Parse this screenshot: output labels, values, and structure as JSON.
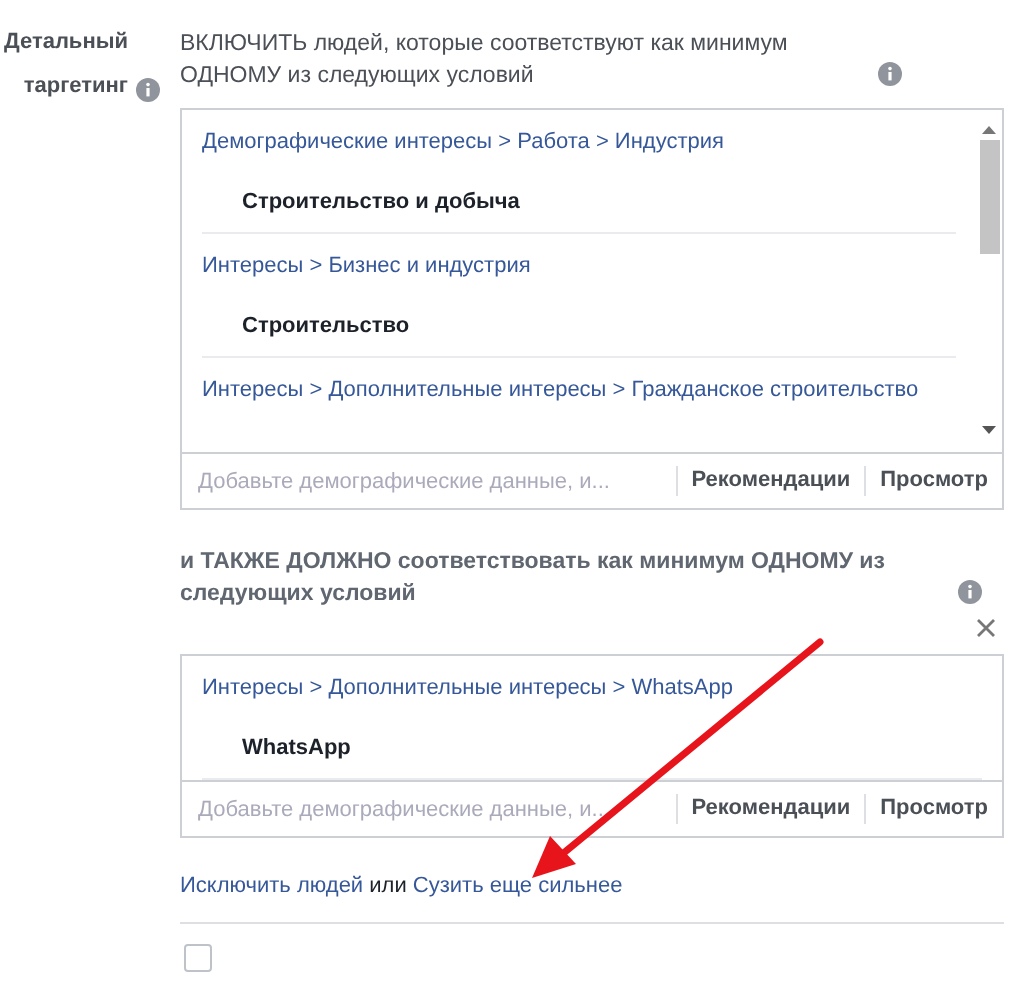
{
  "section_label": "Детальный таргетинг",
  "include": {
    "heading": "ВКЛЮЧИТЬ людей, которые соответствуют как минимум ОДНОМУ из следующих условий",
    "items": [
      {
        "path": "Демографические интересы > Работа > Индустрия",
        "value": "Строительство и добыча"
      },
      {
        "path": "Интересы > Бизнес и индустрия",
        "value": "Строительство"
      },
      {
        "path": "Интересы > Дополнительные интересы > Гражданское строительство"
      }
    ],
    "placeholder": "Добавьте демографические данные, и...",
    "buttons": [
      "Рекомендации",
      "Просмотр"
    ]
  },
  "narrow": {
    "heading": "и ТАКЖЕ ДОЛЖНО соответствовать как минимум ОДНОМУ из следующих условий",
    "items": [
      {
        "path": "Интересы > Дополнительные интересы > WhatsApp",
        "value": "WhatsApp"
      }
    ],
    "placeholder": "Добавьте демографические данные, и...",
    "buttons": [
      "Рекомендации",
      "Просмотр"
    ]
  },
  "links": {
    "exclude": "Исключить людей",
    "or": "или",
    "narrow_further": "Сузить еще сильнее"
  },
  "checkbox": {
    "checked": false
  }
}
